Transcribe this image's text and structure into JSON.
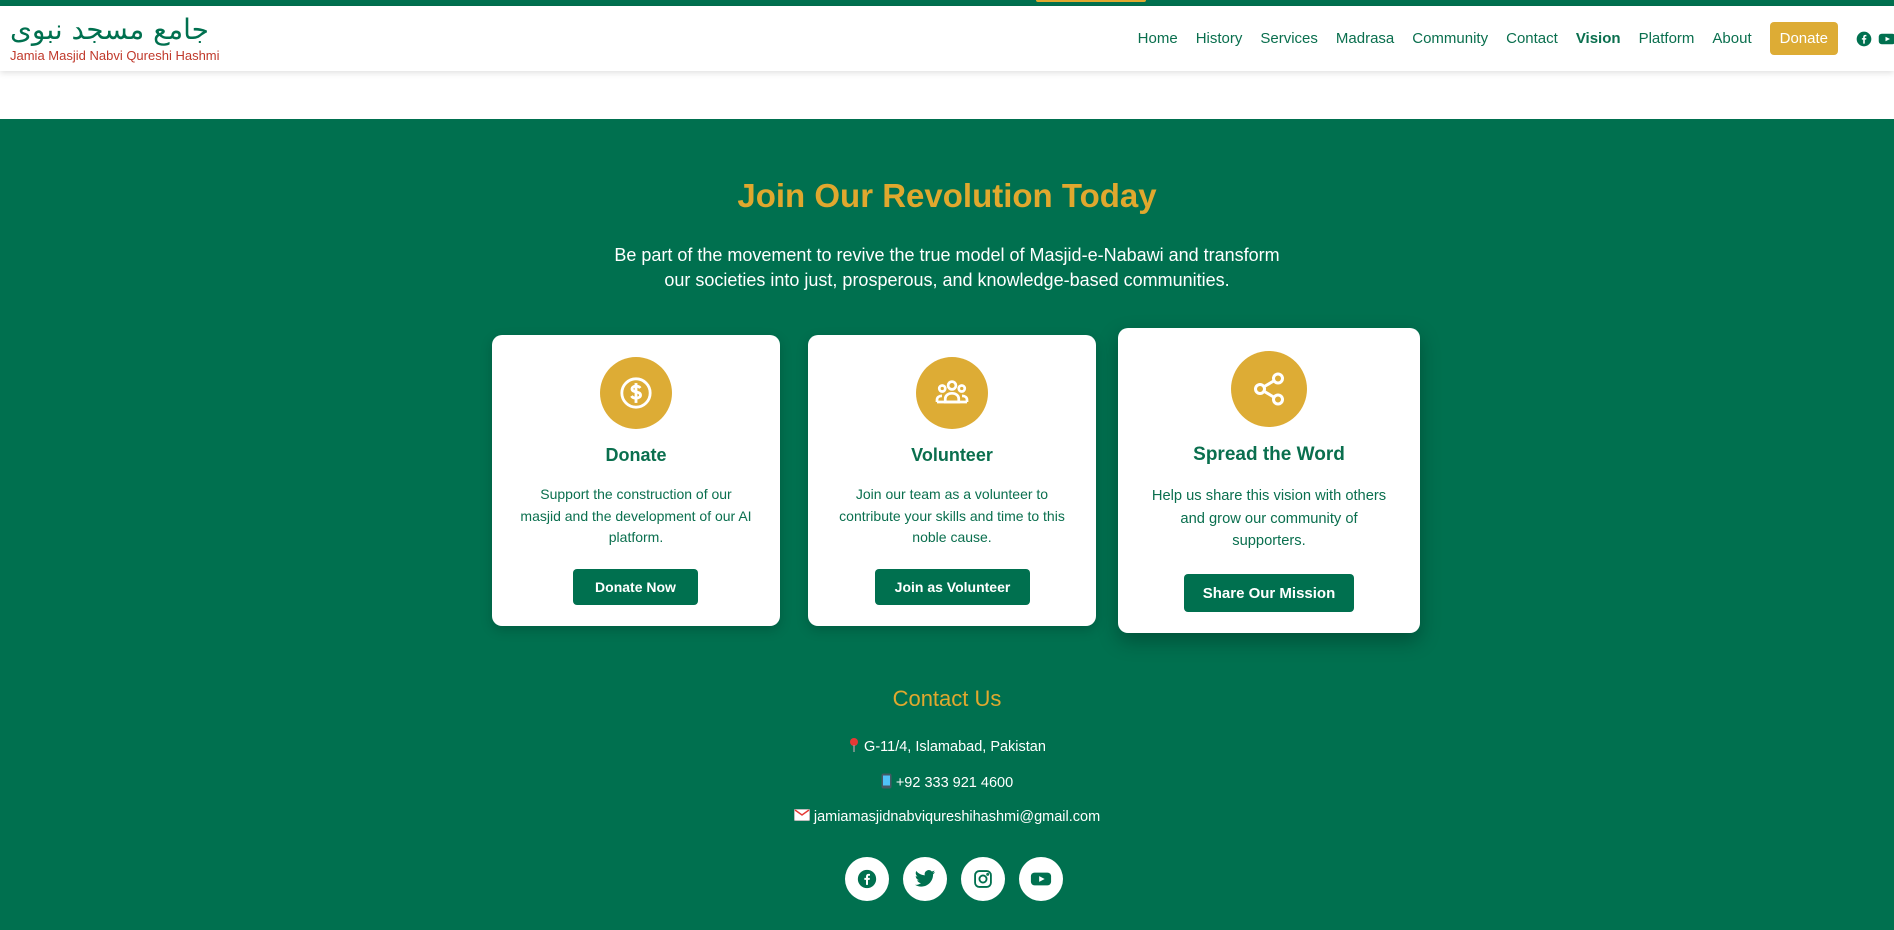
{
  "header": {
    "logo_arabic": "جامع مسجد نبوی",
    "logo_english": "Jamia Masjid Nabvi Qureshi Hashmi",
    "nav": [
      "Home",
      "History",
      "Services",
      "Madrasa",
      "Community",
      "Contact",
      "Vision",
      "Platform",
      "About"
    ],
    "active_nav": "Vision",
    "donate_label": "Donate",
    "social_icons": [
      "facebook-icon",
      "youtube-icon"
    ]
  },
  "join": {
    "heading": "Join Our Revolution Today",
    "subtitle_line1": "Be part of the movement to revive the true model of Masjid-e-Nabawi and transform",
    "subtitle_line2": "our societies into just, prosperous, and knowledge-based communities."
  },
  "cards": [
    {
      "icon": "dollar-icon",
      "title": "Donate",
      "desc_lines": [
        "Support the construction of our",
        "masjid and the development of our AI",
        "platform."
      ],
      "button": "Donate Now"
    },
    {
      "icon": "people-icon",
      "title": "Volunteer",
      "desc_lines": [
        "Join our team as a volunteer to",
        "contribute your skills and time to this",
        "noble cause."
      ],
      "button": "Join as Volunteer"
    },
    {
      "icon": "share-icon",
      "title": "Spread the Word",
      "desc_lines": [
        "Help us share this vision with others",
        "and grow our community of",
        "supporters."
      ],
      "button": "Share Our Mission"
    }
  ],
  "contact": {
    "title": "Contact Us",
    "address": "G-11/4, Islamabad, Pakistan",
    "phone": "+92 333 921 4600",
    "email": "jamiamasjidnabviqureshihashmi@gmail.com"
  },
  "footer_socials": [
    "facebook-icon",
    "twitter-icon",
    "instagram-icon",
    "youtube-icon"
  ],
  "colors": {
    "primary_green": "#00704f",
    "gold": "#ddac35",
    "heading_gold": "#e0a82e",
    "logo_red": "#c0392b"
  }
}
